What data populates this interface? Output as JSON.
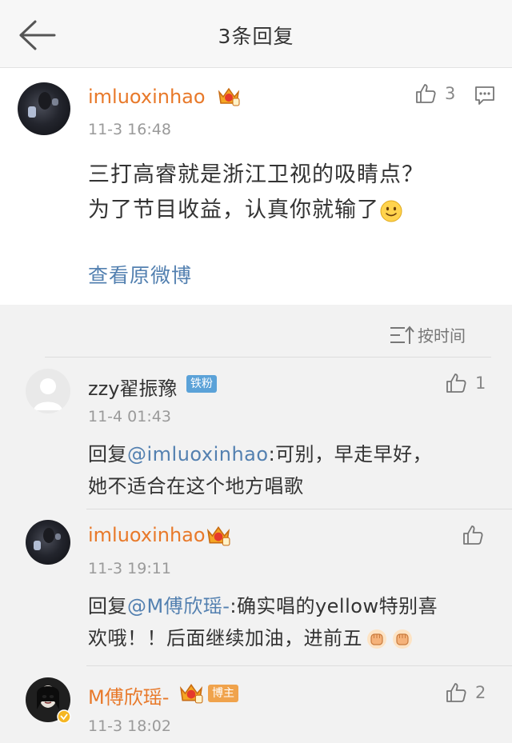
{
  "header": {
    "title": "3条回复"
  },
  "main_post": {
    "username": "imluoxinhao",
    "time": "11-3 16:48",
    "like_count": "3",
    "content_line1": "三打高睿就是浙江卫视的吸睛点？",
    "content_line2": "为了节目收益，认真你就输了",
    "view_original": "查看原微博"
  },
  "sort": {
    "label": "按时间"
  },
  "replies": [
    {
      "username": "zzy翟振豫",
      "badge": "铁粉",
      "time": "11-4 01:43",
      "like_count": "1",
      "prefix": "回复",
      "mention": "@imluoxinhao",
      "text_rest": ":可别，早走早好，",
      "line2": "她不适合在这个地方唱歌"
    },
    {
      "username": "imluoxinhao",
      "time": "11-3 19:11",
      "like_count": "",
      "prefix": "回复",
      "mention": "@M傅欣瑶-",
      "text_rest": ":确实唱的yellow特别喜",
      "line2": "欢哦！！后面继续加油，进前五"
    },
    {
      "username": "M傅欣瑶-",
      "badge": "博主",
      "time": "11-3 18:02",
      "like_count": "2"
    }
  ],
  "icons": {
    "back": "arrow-left",
    "like": "thumbs-up",
    "comment": "speech-bubble",
    "sort": "sort-by-time",
    "vip": "crown",
    "emoji_smile": "smiley",
    "emoji_fist": "fist"
  },
  "colors": {
    "username_vip": "#e8792a",
    "link": "#5380b0",
    "badge_fan": "#5ba2d8",
    "badge_author": "#f0a34c"
  }
}
